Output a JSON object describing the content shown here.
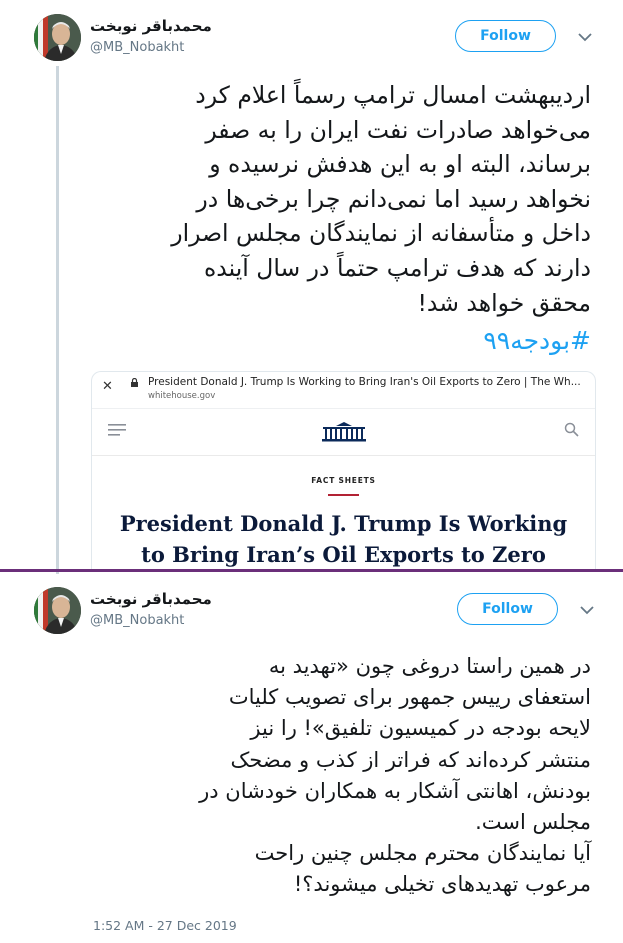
{
  "tweets": [
    {
      "author_name": "محمدباقر نوبخت",
      "author_handle": "@MB_Nobakht",
      "follow_label": "Follow",
      "text_lines": [
        "اردیبهشت امسال ترامپ رسماً اعلام کرد",
        "می‌خواهد صادرات نفت ایران را به صفر",
        "برساند، البته او به این هدفش نرسیده و",
        "نخواهد رسید اما نمی‌دانم چرا برخی‌ها در",
        "داخل و متأسفانه از نمایندگان مجلس اصرار",
        "دارند که هدف ترامپ حتماً در سال آینده",
        "محقق خواهد شد!"
      ],
      "hashtag": "#بودجه۹۹",
      "card": {
        "browser_title": "President Donald J. Trump Is Working to Bring Iran's Oil Exports to Zero | The Wh...",
        "browser_url": "whitehouse.gov",
        "section_label": "FACT SHEETS",
        "headline_lines": [
          "President Donald J. Trump Is Working",
          "to Bring Iran’s Oil Exports to Zero"
        ]
      }
    },
    {
      "author_name": "محمدباقر نوبخت",
      "author_handle": "@MB_Nobakht",
      "follow_label": "Follow",
      "text_lines": [
        "در همین راستا دروغی چون «تهدید به",
        "استعفای رییس جمهور برای تصویب کلیات",
        "لایحه بودجه در کمیسیون تلفیق»! را نیز",
        "منتشر کرده‌اند که فراتر از کذب و مضحک",
        "بودنش، اهانتی آشکار به همکاران خودشان در",
        "مجلس است.",
        "آیا نمایندگان محترم مجلس چنین راحت",
        "مرعوب تهدیدهای تخیلی میشوند؟!"
      ],
      "timestamp": "1:52 AM - 27 Dec 2019"
    }
  ],
  "colors": {
    "accent": "#1da1f2",
    "text": "#14171a",
    "secondary": "#657786",
    "separator": "#6b2f7a"
  }
}
